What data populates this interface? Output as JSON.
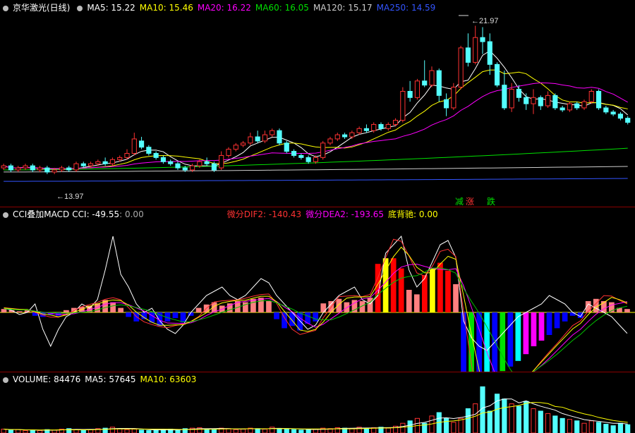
{
  "price": {
    "title": "京华激光(日线)",
    "ma": [
      {
        "label": "MA5: 15.22",
        "color": "#ffffff"
      },
      {
        "label": "MA10: 15.46",
        "color": "#ffff00"
      },
      {
        "label": "MA20: 16.22",
        "color": "#ff00ff"
      },
      {
        "label": "MA60: 16.05",
        "color": "#00e000"
      },
      {
        "label": "MA120: 15.17",
        "color": "#cccccc"
      },
      {
        "label": "MA250: 14.59",
        "color": "#3355ff"
      }
    ],
    "high_label": "21.97",
    "low_label": "13.97",
    "tag_jian": "减",
    "tag_zhang": "涨",
    "tag_die": "跌"
  },
  "indicator": {
    "name": "CCI叠加MACD",
    "cci": "CCI: -49.55",
    "cci2": ": 0.00",
    "dif": "微分DIF2: -140.43",
    "dea": "微分DEA2: -193.65",
    "div": "底背驰: 0.00"
  },
  "volume": {
    "vol": "VOLUME: 84476",
    "ma5": "MA5: 57645",
    "ma10": "MA10: 63603"
  },
  "colors": {
    "up": "#ff3232",
    "down": "#54ffff",
    "bg": "#000000",
    "sep": "#8b0000"
  },
  "candles": [
    [
      15.1,
      15.2,
      15.3,
      15.0
    ],
    [
      15.2,
      15.0,
      15.3,
      14.9
    ],
    [
      15.0,
      15.1,
      15.2,
      14.9
    ],
    [
      15.1,
      15.2,
      15.3,
      15.0
    ],
    [
      15.2,
      15.0,
      15.3,
      14.9
    ],
    [
      15.0,
      15.1,
      15.2,
      14.9
    ],
    [
      15.1,
      14.9,
      15.2,
      14.8
    ],
    [
      14.9,
      15.0,
      15.1,
      14.8
    ],
    [
      15.0,
      15.1,
      15.2,
      14.9
    ],
    [
      15.1,
      15.0,
      15.2,
      14.9
    ],
    [
      15.0,
      15.3,
      15.4,
      14.9
    ],
    [
      15.3,
      15.2,
      15.4,
      15.1
    ],
    [
      15.2,
      15.3,
      15.4,
      15.1
    ],
    [
      15.3,
      15.4,
      15.5,
      15.2
    ],
    [
      15.4,
      15.3,
      15.6,
      15.2
    ],
    [
      15.3,
      15.5,
      15.6,
      15.2
    ],
    [
      15.5,
      15.6,
      15.7,
      15.4
    ],
    [
      15.6,
      15.8,
      16.0,
      15.5
    ],
    [
      15.8,
      16.5,
      16.8,
      15.7
    ],
    [
      16.4,
      16.1,
      16.6,
      16.0
    ],
    [
      16.1,
      15.8,
      16.2,
      15.7
    ],
    [
      15.8,
      15.6,
      15.9,
      15.5
    ],
    [
      15.6,
      15.4,
      15.7,
      15.3
    ],
    [
      15.4,
      15.3,
      15.5,
      15.2
    ],
    [
      15.3,
      15.1,
      15.4,
      15.0
    ],
    [
      15.1,
      15.0,
      15.2,
      14.9
    ],
    [
      15.0,
      15.2,
      15.3,
      14.9
    ],
    [
      15.2,
      15.4,
      15.5,
      15.1
    ],
    [
      15.4,
      15.3,
      15.6,
      15.2
    ],
    [
      15.3,
      15.0,
      15.4,
      14.9
    ],
    [
      15.1,
      15.7,
      15.9,
      15.0
    ],
    [
      15.7,
      16.0,
      16.1,
      15.6
    ],
    [
      16.0,
      16.2,
      16.3,
      15.9
    ],
    [
      16.2,
      16.3,
      16.4,
      16.1
    ],
    [
      16.3,
      16.6,
      16.8,
      16.2
    ],
    [
      16.6,
      16.4,
      16.9,
      16.3
    ],
    [
      16.4,
      16.7,
      16.9,
      16.3
    ],
    [
      16.7,
      16.9,
      17.0,
      16.6
    ],
    [
      16.9,
      16.3,
      17.0,
      16.2
    ],
    [
      16.3,
      15.9,
      16.4,
      15.8
    ],
    [
      15.9,
      15.7,
      16.0,
      15.6
    ],
    [
      15.7,
      15.6,
      15.8,
      15.5
    ],
    [
      15.6,
      15.4,
      15.7,
      15.3
    ],
    [
      15.4,
      15.6,
      15.7,
      15.3
    ],
    [
      15.6,
      16.3,
      16.4,
      15.5
    ],
    [
      16.3,
      16.5,
      16.6,
      16.2
    ],
    [
      16.5,
      16.7,
      16.8,
      16.4
    ],
    [
      16.7,
      16.6,
      16.8,
      16.5
    ],
    [
      16.6,
      16.8,
      16.9,
      16.5
    ],
    [
      16.8,
      17.0,
      17.1,
      16.7
    ],
    [
      17.0,
      16.9,
      17.2,
      16.8
    ],
    [
      16.9,
      17.2,
      17.3,
      16.8
    ],
    [
      17.2,
      17.0,
      17.3,
      16.9
    ],
    [
      17.0,
      17.2,
      17.3,
      16.9
    ],
    [
      17.2,
      17.4,
      17.5,
      17.1
    ],
    [
      17.4,
      18.8,
      19.0,
      17.3
    ],
    [
      18.8,
      18.5,
      19.3,
      18.3
    ],
    [
      18.5,
      19.3,
      19.4,
      18.4
    ],
    [
      19.3,
      19.1,
      20.3,
      19.0
    ],
    [
      19.1,
      19.8,
      20.0,
      19.0
    ],
    [
      19.8,
      18.6,
      19.9,
      18.3
    ],
    [
      18.4,
      18.0,
      18.7,
      17.6
    ],
    [
      18.0,
      19.0,
      19.2,
      17.9
    ],
    [
      19.0,
      20.9,
      21.0,
      18.9
    ],
    [
      20.9,
      20.2,
      21.6,
      20.0
    ],
    [
      20.2,
      21.4,
      21.97,
      20.1
    ],
    [
      21.4,
      21.2,
      21.9,
      20.6
    ],
    [
      21.2,
      20.1,
      21.6,
      19.6
    ],
    [
      20.1,
      19.1,
      20.2,
      19.0
    ],
    [
      19.1,
      18.0,
      19.8,
      17.9
    ],
    [
      18.0,
      18.9,
      19.2,
      17.8
    ],
    [
      18.9,
      18.5,
      19.1,
      18.3
    ],
    [
      18.5,
      18.2,
      18.7,
      17.9
    ],
    [
      18.2,
      18.5,
      18.9,
      17.7
    ],
    [
      18.5,
      18.1,
      18.6,
      17.9
    ],
    [
      18.1,
      18.6,
      18.8,
      18.0
    ],
    [
      18.6,
      18.0,
      18.7,
      17.9
    ],
    [
      18.0,
      17.9,
      18.1,
      17.8
    ],
    [
      17.9,
      18.2,
      18.3,
      17.8
    ],
    [
      18.2,
      18.0,
      18.3,
      17.9
    ],
    [
      18.0,
      18.3,
      18.4,
      17.9
    ],
    [
      18.3,
      18.8,
      18.9,
      18.2
    ],
    [
      18.8,
      18.0,
      18.9,
      17.9
    ],
    [
      18.0,
      17.8,
      18.1,
      17.7
    ],
    [
      17.8,
      17.7,
      17.9,
      17.6
    ],
    [
      17.7,
      17.5,
      17.8,
      17.4
    ],
    [
      17.5,
      17.3,
      17.6,
      17.2
    ]
  ],
  "macd": [
    0.3,
    0.2,
    0.1,
    0.2,
    -0.3,
    -0.4,
    -0.2,
    -0.3,
    0.2,
    0.4,
    0.5,
    0.6,
    0.8,
    1.1,
    0.9,
    0.4,
    -0.4,
    -0.8,
    -0.6,
    -0.9,
    -1.2,
    -0.8,
    -0.5,
    -0.9,
    -0.3,
    0.4,
    0.7,
    0.9,
    0.6,
    0.8,
    1.0,
    0.9,
    1.2,
    1.3,
    1.0,
    -0.6,
    -1.4,
    -1.2,
    -1.6,
    -1.0,
    -0.8,
    0.8,
    1.0,
    1.2,
    0.9,
    1.1,
    1.0,
    1.3,
    4.3,
    4.8,
    4.8,
    3.9,
    2.0,
    1.6,
    3.3,
    3.9,
    4.4,
    3.7,
    2.5,
    -6.0,
    -6.2,
    -6.0,
    -5.7,
    -5.3,
    -5.2,
    -4.8,
    -4.3,
    -3.7,
    -3.0,
    -2.5,
    -2.0,
    -1.4,
    -0.8,
    -0.3,
    -0.5,
    1.0,
    1.2,
    1.0,
    0.9,
    0.4,
    0.3
  ],
  "cci": [
    10,
    5,
    -5,
    0,
    20,
    -40,
    -80,
    -40,
    -10,
    0,
    20,
    10,
    30,
    100,
    180,
    90,
    60,
    20,
    0,
    10,
    -20,
    -40,
    -50,
    -30,
    0,
    20,
    40,
    50,
    60,
    40,
    30,
    40,
    60,
    80,
    70,
    40,
    20,
    0,
    -20,
    -40,
    -30,
    0,
    20,
    40,
    50,
    60,
    30,
    20,
    40,
    140,
    160,
    180,
    100,
    60,
    80,
    120,
    160,
    170,
    130,
    -20,
    -60,
    -80,
    -90,
    -70,
    -50,
    -30,
    -10,
    0,
    10,
    20,
    40,
    30,
    20,
    0,
    -10,
    20,
    10,
    0,
    -10,
    -30,
    -49.55
  ],
  "vol": [
    0.08,
    0.06,
    0.07,
    0.05,
    0.06,
    0.05,
    0.07,
    0.06,
    0.08,
    0.09,
    0.07,
    0.06,
    0.07,
    0.09,
    0.1,
    0.12,
    0.09,
    0.07,
    0.08,
    0.06,
    0.05,
    0.06,
    0.07,
    0.08,
    0.06,
    0.09,
    0.1,
    0.11,
    0.08,
    0.07,
    0.1,
    0.09,
    0.07,
    0.08,
    0.1,
    0.09,
    0.08,
    0.12,
    0.09,
    0.08,
    0.07,
    0.06,
    0.07,
    0.08,
    0.1,
    0.09,
    0.11,
    0.1,
    0.09,
    0.12,
    0.1,
    0.11,
    0.12,
    0.1,
    0.14,
    0.2,
    0.25,
    0.3,
    0.2,
    0.35,
    0.42,
    0.3,
    0.22,
    0.3,
    0.5,
    0.6,
    0.95,
    0.45,
    0.8,
    0.7,
    0.6,
    0.55,
    0.65,
    0.5,
    0.45,
    0.4,
    0.35,
    0.3,
    0.28,
    0.25,
    0.2,
    0.25,
    0.22,
    0.18,
    0.15,
    0.2,
    0.17
  ]
}
